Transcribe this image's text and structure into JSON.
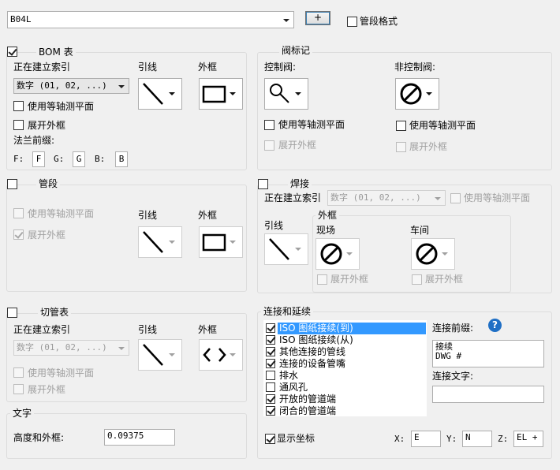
{
  "top": {
    "style_value": "B04L",
    "plus_label": "+",
    "pipe_format_label": "管段格式"
  },
  "bom": {
    "title": "BOM 表",
    "indexing_label": "正在建立索引",
    "index_value": "数字 (01, 02, ...)",
    "leader_label": "引线",
    "frame_label": "外框",
    "isometric_label": "使用等轴测平面",
    "expand_label": "展开外框",
    "flange_prefix_label": "法兰前缀:",
    "f_label": "F:",
    "f_value": "F",
    "g_label": "G:",
    "g_value": "G",
    "b_label": "B:",
    "b_value": "B"
  },
  "valve": {
    "title": "阀标记",
    "control_label": "控制阀:",
    "noncontrol_label": "非控制阀:",
    "isometric_label": "使用等轴测平面",
    "expand_label": "展开外框",
    "isometric2_label": "使用等轴测平面",
    "expand2_label": "展开外框"
  },
  "segment": {
    "title": "管段",
    "isometric_label": "使用等轴测平面",
    "expand_label": "展开外框",
    "leader_label": "引线",
    "frame_label": "外框"
  },
  "weld": {
    "title": "焊接",
    "indexing_label": "正在建立索引",
    "index_value": "数字 (01, 02, ...)",
    "isometric_label": "使用等轴测平面",
    "leader_label": "引线",
    "frame_title": "外框",
    "field_label": "现场",
    "shop_label": "车间",
    "expand_field_label": "展开外框",
    "expand_shop_label": "展开外框"
  },
  "cut": {
    "title": "切管表",
    "indexing_label": "正在建立索引",
    "index_value": "数字 (01, 02, ...)",
    "leader_label": "引线",
    "frame_label": "外框",
    "isometric_label": "使用等轴测平面",
    "expand_label": "展开外框"
  },
  "text": {
    "title": "文字",
    "height_label": "高度和外框:",
    "height_value": "0.09375"
  },
  "connections": {
    "title": "连接和延续",
    "items": [
      {
        "label": "ISO 图纸接续(到)",
        "checked": true,
        "selected": true
      },
      {
        "label": "ISO 图纸接续(从)",
        "checked": true
      },
      {
        "label": "其他连接的管线",
        "checked": true
      },
      {
        "label": "连接的设备管嘴",
        "checked": true
      },
      {
        "label": "排水",
        "checked": false
      },
      {
        "label": "通风孔",
        "checked": false
      },
      {
        "label": "开放的管道端",
        "checked": true
      },
      {
        "label": "闭合的管道端",
        "checked": true
      }
    ],
    "prefix_label": "连接前缀:",
    "prefix_value": "接续\nDWG #",
    "text_label": "连接文字:",
    "text_value": "",
    "show_coords_label": "显示坐标",
    "x_label": "X:",
    "x_value": "E",
    "y_label": "Y:",
    "y_value": "N",
    "z_label": "Z:",
    "z_value": "EL +"
  },
  "colors": {
    "accent": "#3399ff",
    "help": "#1f6fc5"
  }
}
